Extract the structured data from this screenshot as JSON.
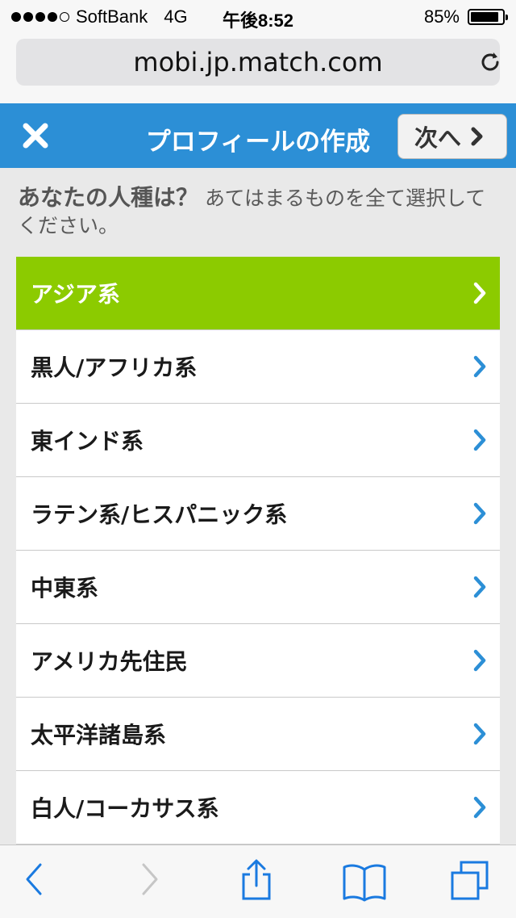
{
  "status_bar": {
    "carrier": "SoftBank",
    "network": "4G",
    "time": "午後8:52",
    "battery": "85%",
    "signal_bars": 4
  },
  "browser": {
    "url": "mobi.jp.match.com"
  },
  "header": {
    "title": "プロフィールの作成",
    "next_label": "次へ"
  },
  "prompt": {
    "question": "あなたの人種は？",
    "instruction": "あてはまるものを全て選択してください。"
  },
  "options": [
    {
      "label": "アジア系",
      "selected": true
    },
    {
      "label": "黒人/アフリカ系",
      "selected": false
    },
    {
      "label": "東インド系",
      "selected": false
    },
    {
      "label": "ラテン系/ヒスパニック系",
      "selected": false
    },
    {
      "label": "中東系",
      "selected": false
    },
    {
      "label": "アメリカ先住民",
      "selected": false
    },
    {
      "label": "太平洋諸島系",
      "selected": false
    },
    {
      "label": "白人/コーカサス系",
      "selected": false
    }
  ],
  "colors": {
    "header_blue": "#2c8fd6",
    "selected_green": "#8ccb00",
    "chevron_blue": "#2c8fd6",
    "toolbar_blue": "#1a7ae0"
  },
  "toolbar_icons": [
    "back-icon",
    "forward-icon",
    "share-icon",
    "bookmarks-icon",
    "tabs-icon"
  ]
}
